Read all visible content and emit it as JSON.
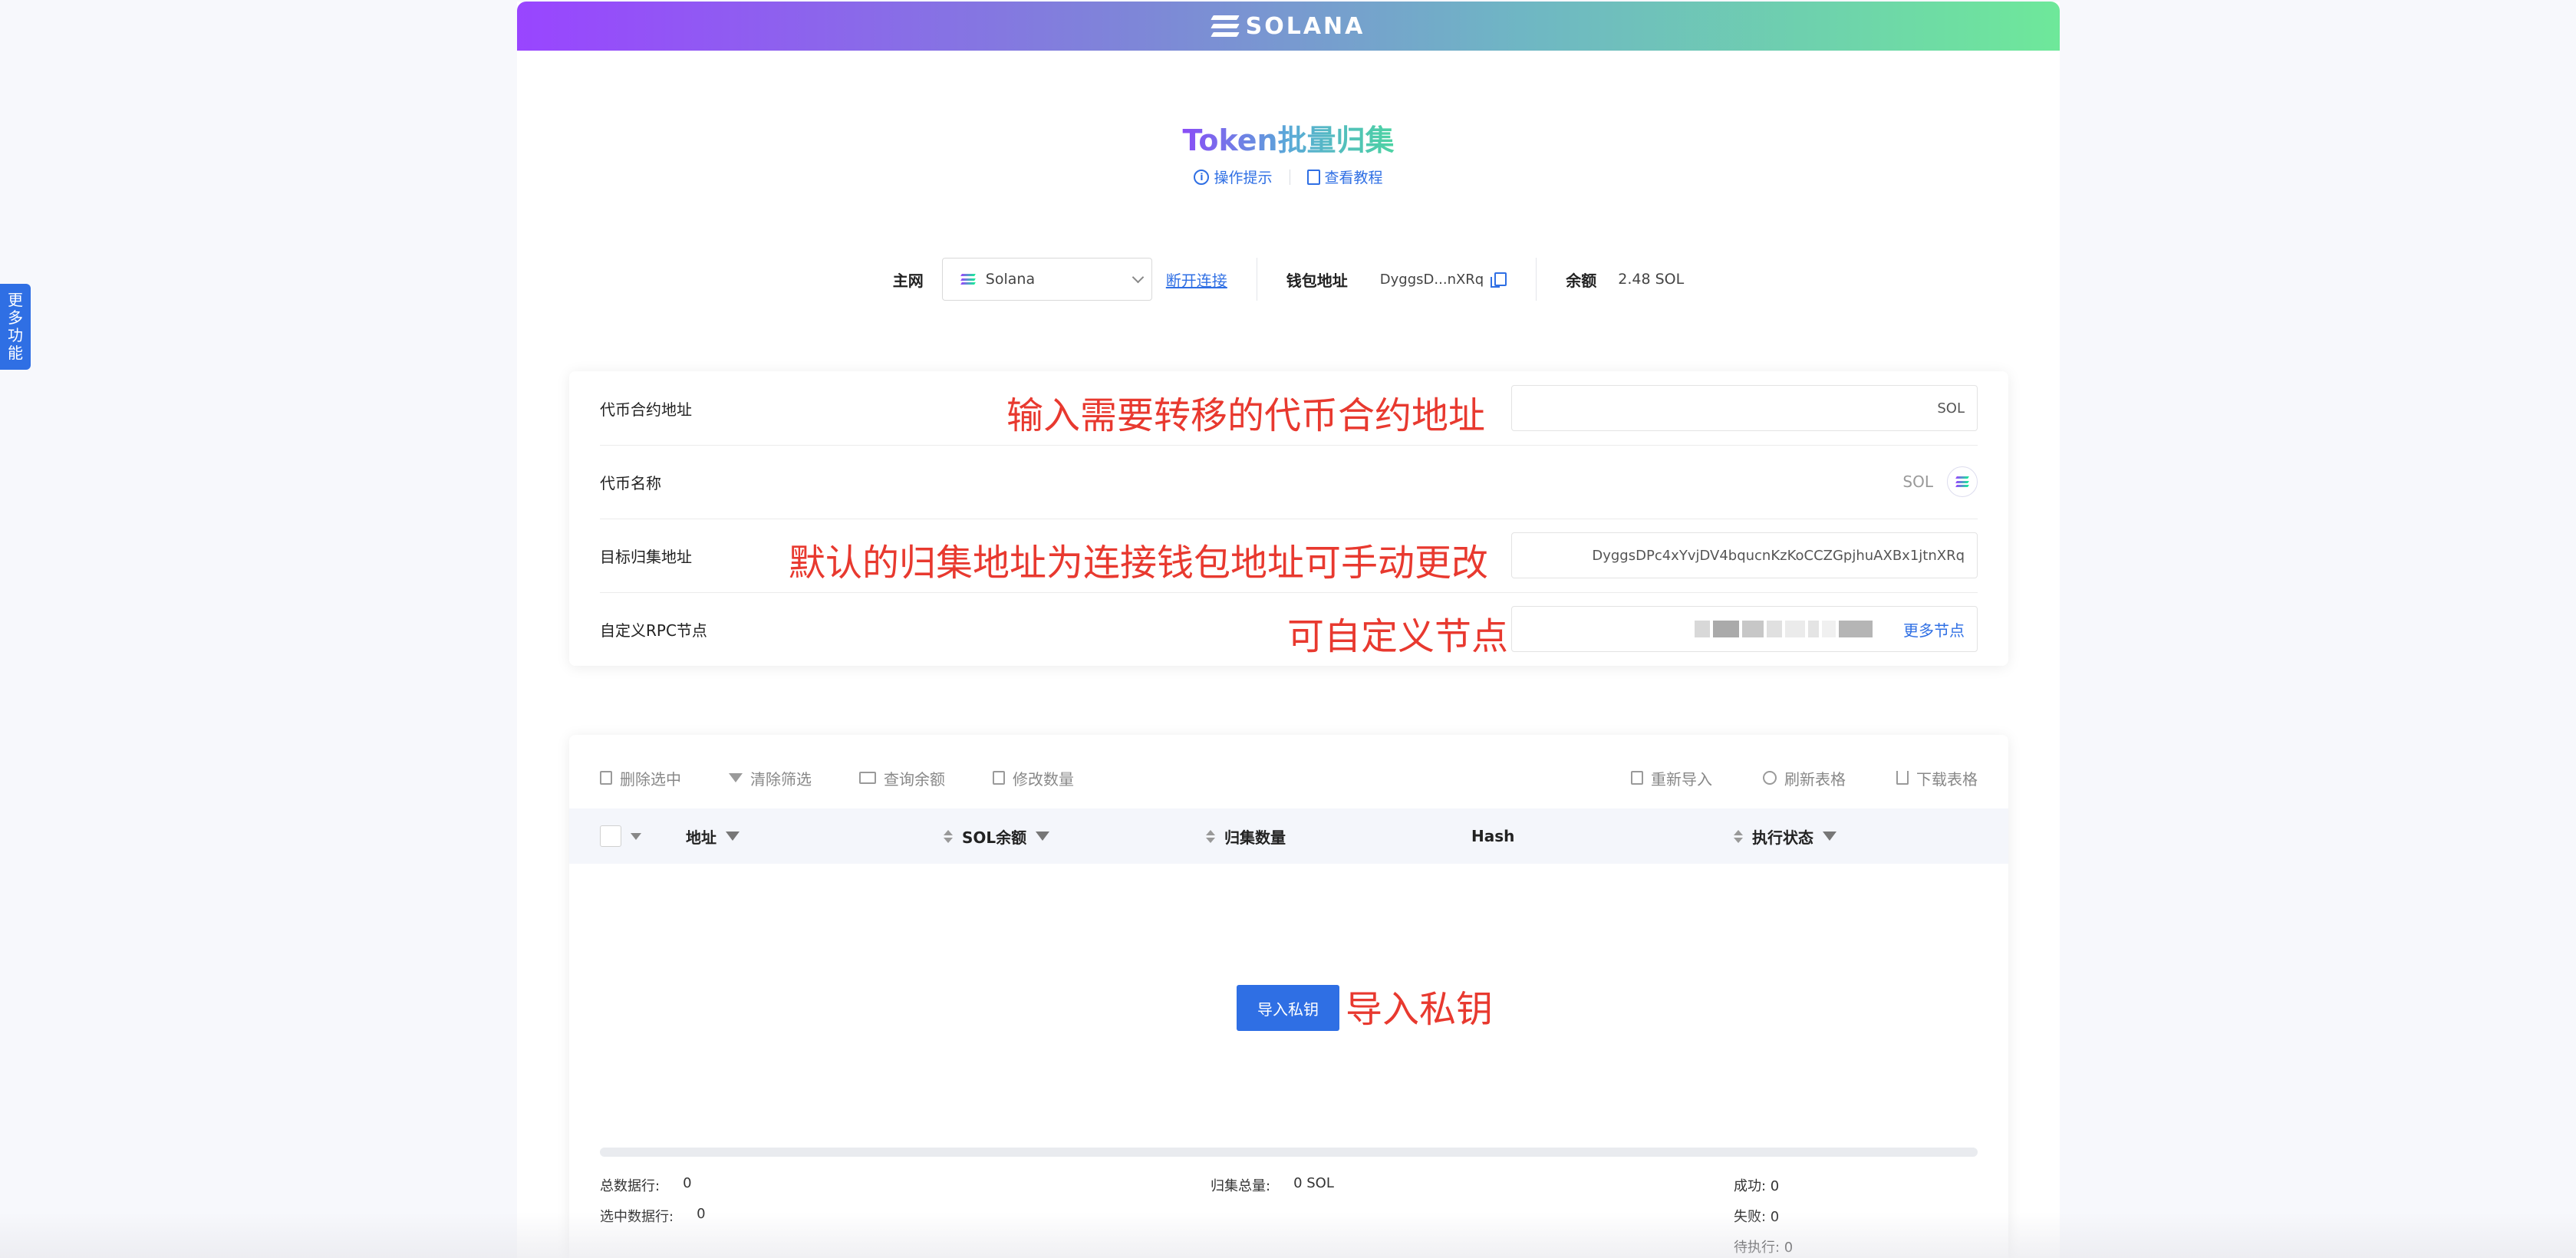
{
  "banner": {
    "logo_text": "SOLANA"
  },
  "header": {
    "title": "Token批量归集",
    "hint_ops": "操作提示",
    "hint_tutorial": "查看教程"
  },
  "network": {
    "label": "主网",
    "selected": "Solana",
    "disconnect": "断开连接",
    "wallet_label": "钱包地址",
    "wallet_addr": "DyggsD...nXRq",
    "balance_label": "余额",
    "balance_value": "2.48 SOL"
  },
  "form": {
    "contract_label": "代币合约地址",
    "contract_annotation": "输入需要转移的代币合约地址",
    "contract_suffix": "SOL",
    "token_name_label": "代币名称",
    "token_name_value": "SOL",
    "target_label": "目标归集地址",
    "target_annotation": "默认的归集地址为连接钱包地址可手动更改",
    "target_value": "DyggsDPc4xYvjDV4bqucnKzKoCCZGpjhuAXBx1jtnXRq",
    "rpc_label": "自定义RPC节点",
    "rpc_annotation": "可自定义节点",
    "rpc_more": "更多节点"
  },
  "toolbar": {
    "delete_selected": "删除选中",
    "clear_filter": "清除筛选",
    "query_balance": "查询余额",
    "edit_amount": "修改数量",
    "reimport": "重新导入",
    "refresh": "刷新表格",
    "download": "下载表格"
  },
  "table": {
    "columns": [
      "地址",
      "SOL余额",
      "归集数量",
      "Hash",
      "执行状态"
    ],
    "import_button": "导入私钥",
    "import_annotation": "导入私钥"
  },
  "stats": {
    "total_rows_label": "总数据行:",
    "total_rows": "0",
    "selected_rows_label": "选中数据行:",
    "selected_rows": "0",
    "collect_total_label": "归集总量:",
    "collect_total": "0 SOL",
    "success": "成功: 0",
    "failed": "失败: 0",
    "pending": "待执行: 0"
  },
  "side": {
    "more_features": [
      "更",
      "多",
      "功",
      "能"
    ]
  },
  "colors": {
    "accent": "#2f6fe4",
    "annotation": "#e8392f",
    "brand_start": "#9945ff",
    "brand_end": "#6ee89a"
  }
}
